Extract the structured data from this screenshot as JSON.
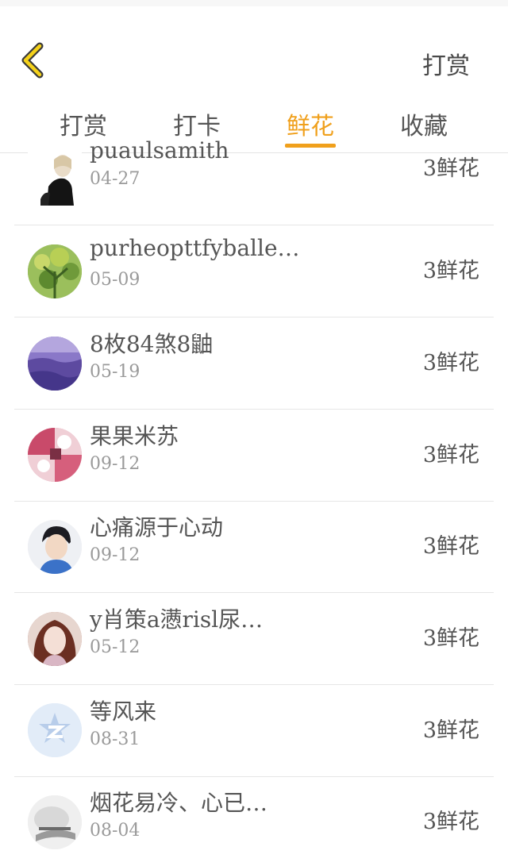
{
  "header": {
    "back_icon": "chevron-left-icon",
    "action_label": "打赏",
    "accent_color": "#f0a01c"
  },
  "tabs": [
    {
      "label": "打赏",
      "active": false
    },
    {
      "label": "打卡",
      "active": false
    },
    {
      "label": "鲜花",
      "active": true
    },
    {
      "label": "收藏",
      "active": false
    }
  ],
  "list": [
    {
      "name": "puaulsamith",
      "date": "04-27",
      "amount": "3鲜花"
    },
    {
      "name": "purheopttfyballe…",
      "date": "05-09",
      "amount": "3鲜花"
    },
    {
      "name": "8枚84煞8鼬",
      "date": "05-19",
      "amount": "3鲜花"
    },
    {
      "name": "果果米苏",
      "date": "09-12",
      "amount": "3鲜花"
    },
    {
      "name": "心痛源于心动",
      "date": "09-12",
      "amount": "3鲜花"
    },
    {
      "name": "y肖策a懑risl尿…",
      "date": "05-12",
      "amount": "3鲜花"
    },
    {
      "name": "等风来",
      "date": "08-31",
      "amount": "3鲜花"
    },
    {
      "name": "烟花易冷、心已…",
      "date": "08-04",
      "amount": "3鲜花"
    }
  ]
}
